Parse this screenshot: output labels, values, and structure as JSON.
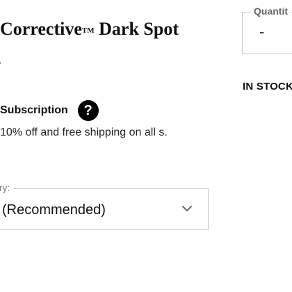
{
  "product": {
    "title_main": "Corrective",
    "title_tm": "TM",
    "title_rest": " Dark Spot",
    "title_cont": "-"
  },
  "subscription": {
    "label": "Subscription",
    "help_glyph": "?",
    "description": "10% off and free shipping on all s."
  },
  "delivery": {
    "label": "ery:",
    "selected": "(Recommended)",
    "chevron_icon": "chevron-down-icon"
  },
  "quantity": {
    "label": "Quantit",
    "minus_glyph": "-"
  },
  "stock": {
    "status": "IN STOCK"
  },
  "colors": {
    "text": "#111111",
    "border": "#c8c8c8",
    "muted": "#777777",
    "help_bg": "#000000"
  }
}
